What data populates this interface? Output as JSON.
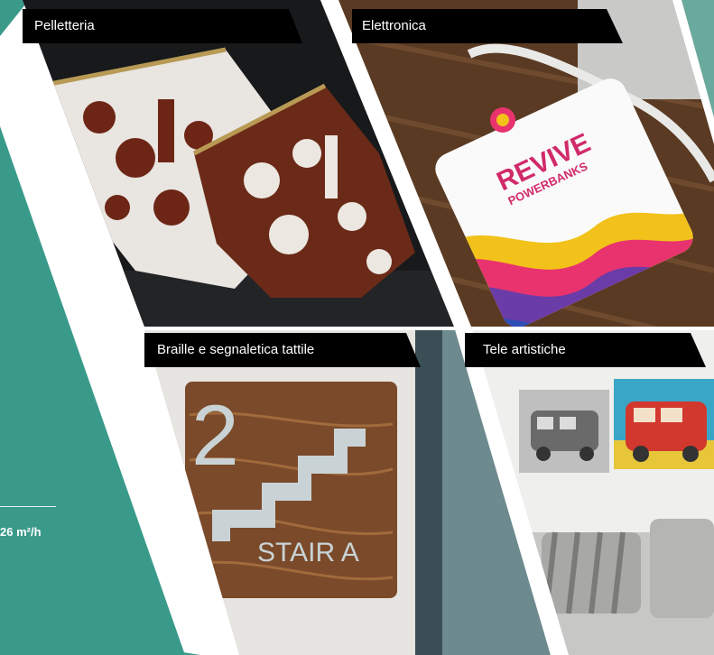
{
  "labels": {
    "pelletteria": "Pelletteria",
    "elettronica": "Elettronica",
    "braille": "Braille e segnaletica tattile",
    "tele": "Tele artistiche"
  },
  "sidebar": {
    "stat": "26 m²/h"
  },
  "products": {
    "powerbank_brand": "REVIVE",
    "powerbank_sub": "POWERBANKS",
    "sign_number": "2",
    "sign_text": "STAIR A"
  },
  "colors": {
    "teal": "#3a9a8a",
    "label_bg": "#000000"
  }
}
